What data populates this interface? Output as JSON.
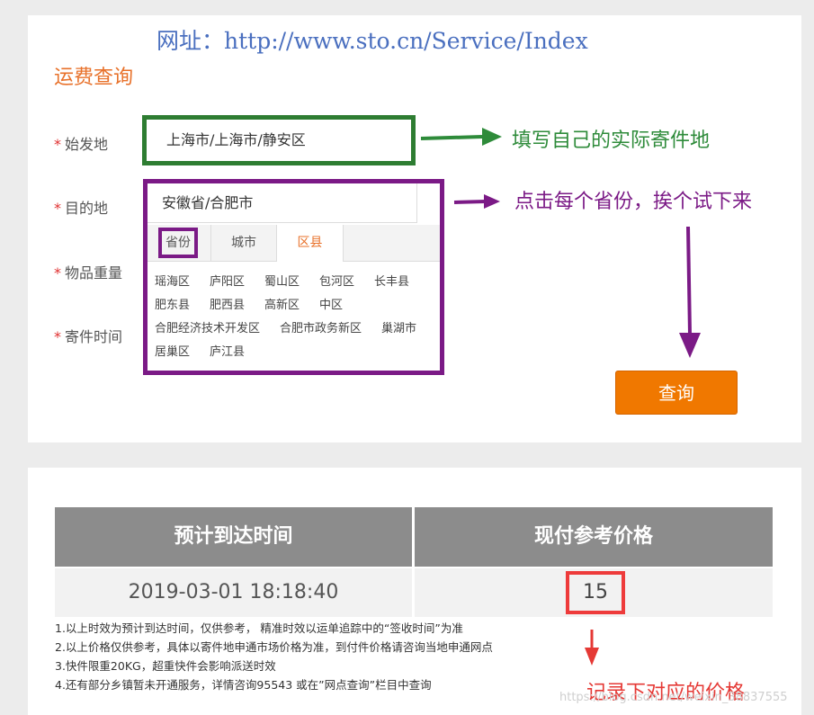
{
  "url_note": "网址：http://www.sto.cn/Service/Index",
  "section_title": "运费查询",
  "form": {
    "required_mark": "*",
    "origin_label": "始发地",
    "destination_label": "目的地",
    "weight_label": "物品重量",
    "time_label": "寄件时间",
    "origin_value": "上海市/上海市/静安区",
    "destination_value": "安徽省/合肥市",
    "tabs": [
      "省份",
      "城市",
      "区县"
    ],
    "districts": [
      [
        "瑶海区",
        "庐阳区",
        "蜀山区",
        "包河区",
        "长丰县"
      ],
      [
        "肥东县",
        "肥西县",
        "高新区",
        "中区"
      ],
      [
        "合肥经济技术开发区",
        "合肥市政务新区",
        "巢湖市"
      ],
      [
        "居巢区",
        "庐江县"
      ]
    ]
  },
  "annotations": {
    "fill_origin": "填写自己的实际寄件地",
    "click_province": "点击每个省份，挨个试下来",
    "record_price": "记录下对应的价格"
  },
  "query_button": "查询",
  "result": {
    "headers": [
      "预计到达时间",
      "现付参考价格"
    ],
    "arrival_time": "2019-03-01 18:18:40",
    "price": "15"
  },
  "notes": [
    "1.以上时效为预计到达时间，仅供参考， 精准时效以运单追踪中的“签收时间”为准",
    "2.以上价格仅供参考，具体以寄件地申通市场价格为准，到付件价格请咨询当地申通网点",
    "3.快件限重20KG，超重快件会影响派送时效",
    "4.还有部分乡镇暂未开通服务，详情咨询95543 或在”网点查询”栏目中查询"
  ],
  "watermark": "https://blog.csdn.net/weixin_38837555",
  "colors": {
    "accent_orange": "#f07800",
    "green_annotation": "#2e7d32",
    "purple_annotation": "#7b1a86",
    "red_annotation": "#ee3b3b",
    "table_header": "#8c8c8c"
  }
}
